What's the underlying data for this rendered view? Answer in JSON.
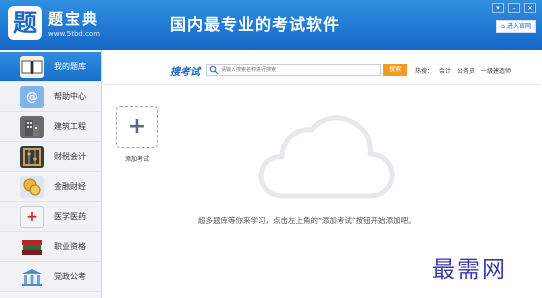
{
  "header": {
    "logo_char": "题",
    "app_name": "题宝典",
    "app_url": "www.5tbd.com",
    "slogan": "国内最专业的考试软件",
    "enter_site_label": "进入官网"
  },
  "sidebar": {
    "items": [
      {
        "label": "我的题库",
        "icon": "book-icon",
        "active": true
      },
      {
        "label": "帮助中心",
        "icon": "help-icon",
        "active": false
      },
      {
        "label": "建筑工程",
        "icon": "building-icon",
        "active": false
      },
      {
        "label": "财税会计",
        "icon": "abacus-icon",
        "active": false
      },
      {
        "label": "金融财经",
        "icon": "coins-icon",
        "active": false
      },
      {
        "label": "医学医药",
        "icon": "medical-kit-icon",
        "active": false
      },
      {
        "label": "职业资格",
        "icon": "books-stack-icon",
        "active": false
      },
      {
        "label": "党政公考",
        "icon": "government-building-icon",
        "active": false
      }
    ]
  },
  "search": {
    "title": "搜考试",
    "placeholder": "请输入搜索名称进行搜索",
    "button_label": "搜索",
    "hot_label": "热搜：",
    "hot_links": [
      "会计",
      "公务员",
      "一级建造师"
    ]
  },
  "main": {
    "add_label": "添加考试",
    "hint": "超多题库等你来学习，点击左上角的“添加考试”按钮开始添加吧。"
  },
  "watermark": "最需网",
  "colors": {
    "header_blue": "#1668c7",
    "search_button": "#f39a1f",
    "watermark": "#3a3aa8"
  }
}
